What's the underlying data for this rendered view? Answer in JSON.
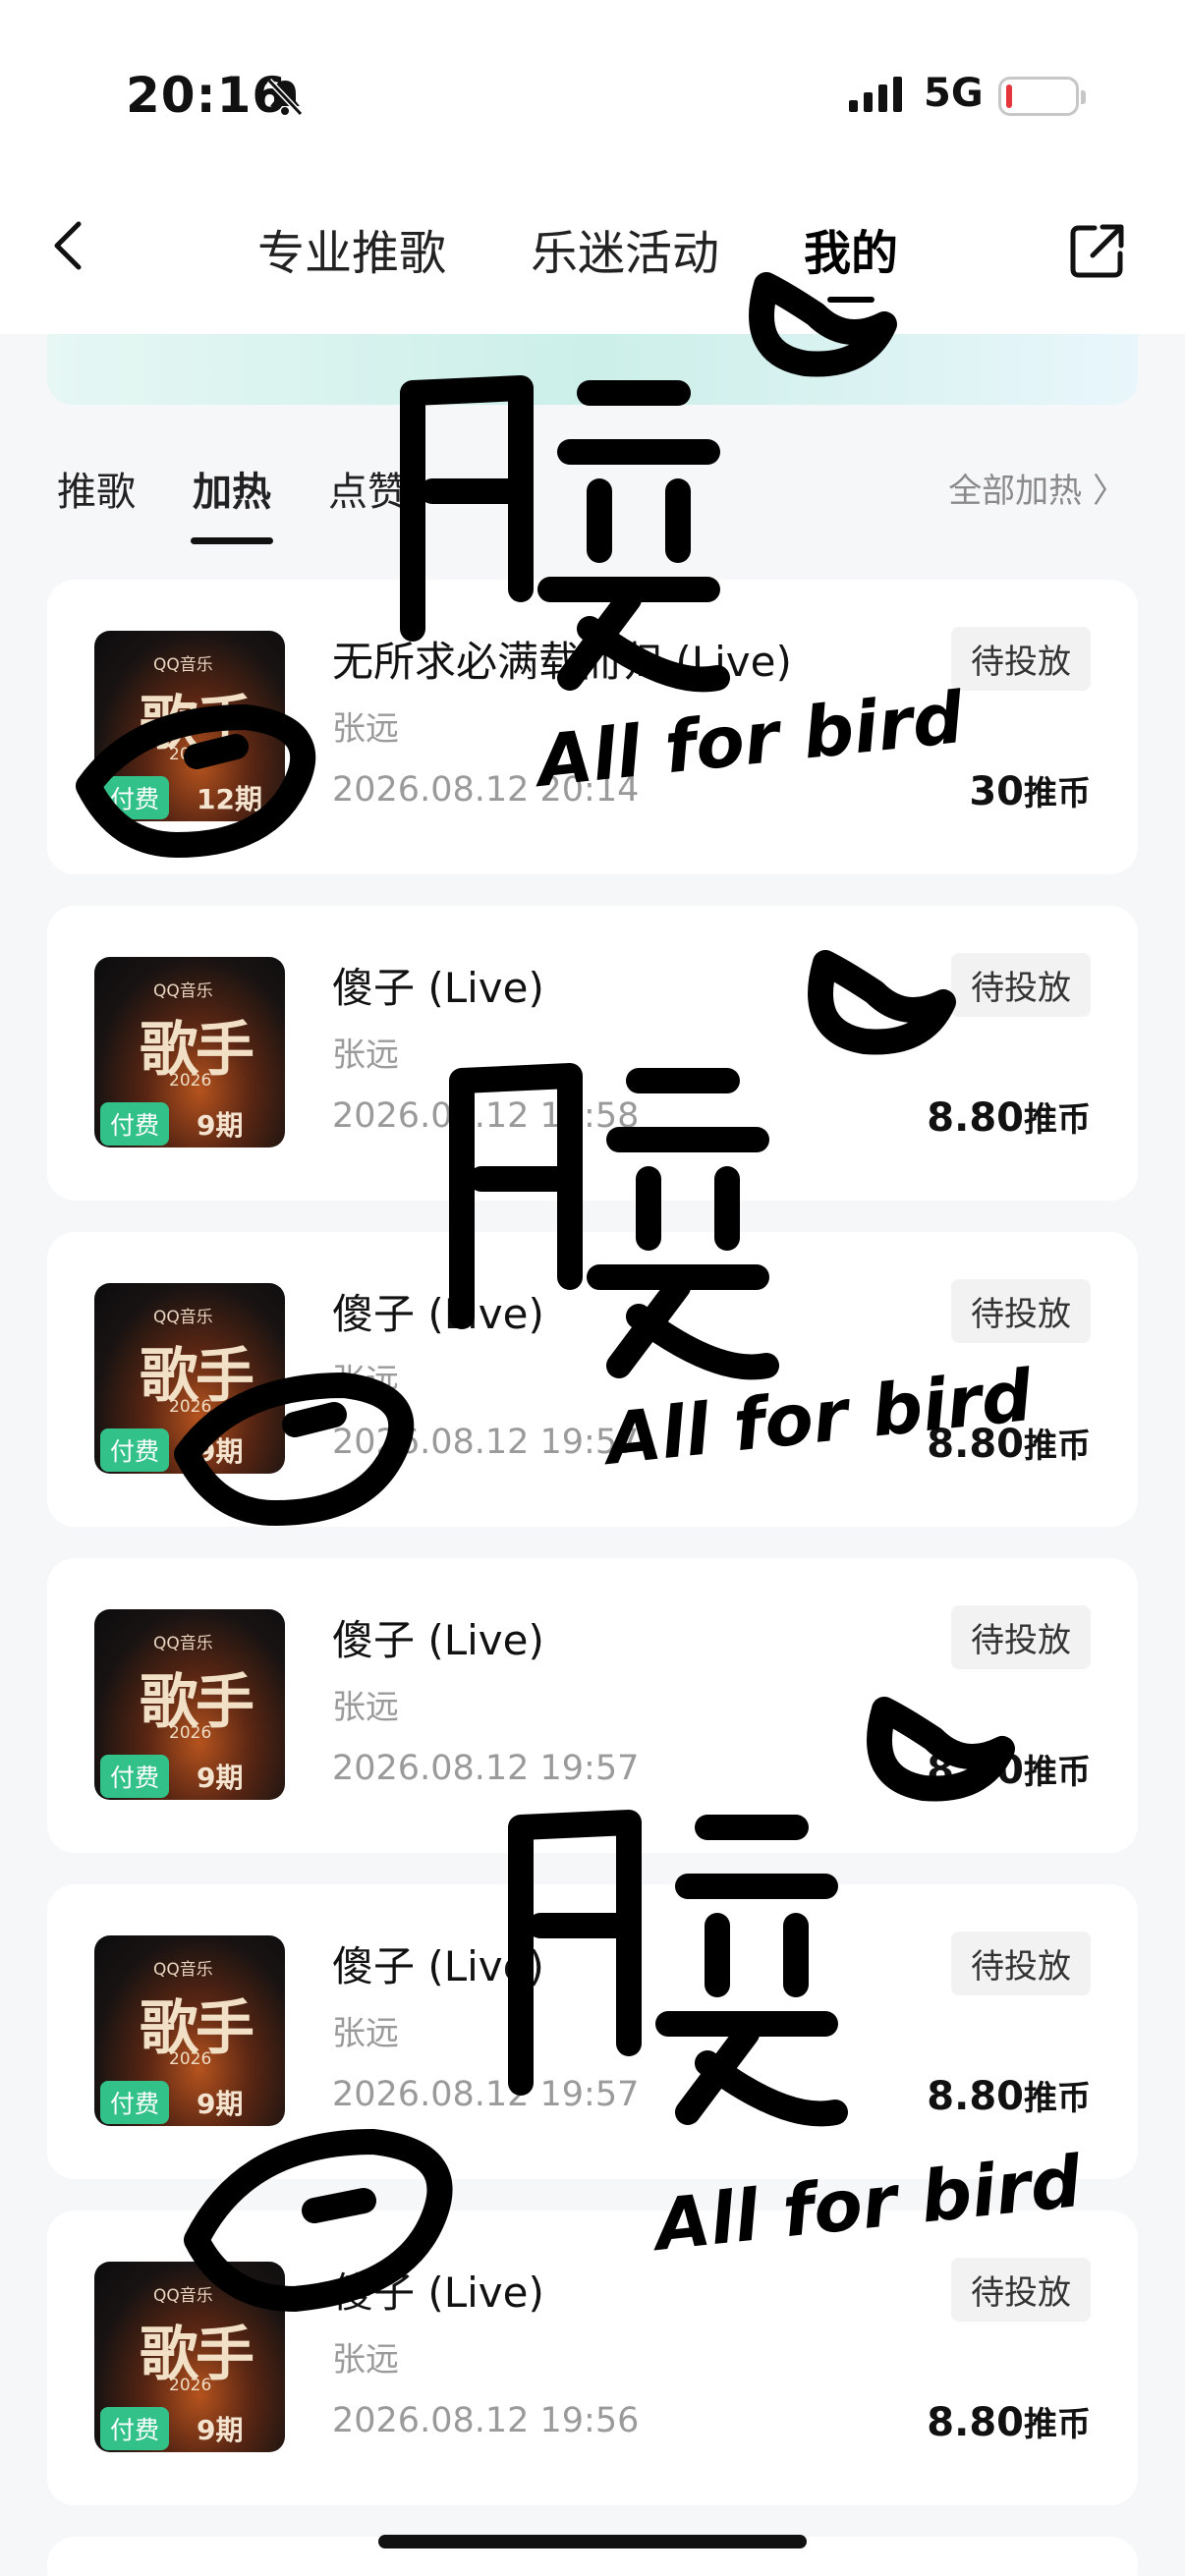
{
  "status_bar": {
    "time": "20:16",
    "network": "5G"
  },
  "nav": {
    "tabs": [
      {
        "label": "专业推歌"
      },
      {
        "label": "乐迷活动"
      },
      {
        "label": "我的"
      }
    ]
  },
  "sub_tabs": [
    {
      "label": "推歌"
    },
    {
      "label": "加热"
    },
    {
      "label": "点赞"
    }
  ],
  "all_boost": "全部加热 〉",
  "cover": {
    "brand": "QQ音乐",
    "show": "歌手",
    "year": "2026",
    "paid_badge": "付费"
  },
  "items": [
    {
      "song": "无所求必满载而归 (Live)",
      "artist": "张远",
      "time": "2026.08.12 20:14",
      "status": "待投放",
      "amount": "30",
      "unit": "推币",
      "episode": "12期"
    },
    {
      "song": "傻子 (Live)",
      "artist": "张远",
      "time": "2026.08.12 19:58",
      "status": "待投放",
      "amount": "8.80",
      "unit": "推币",
      "episode": "9期"
    },
    {
      "song": "傻子 (Live)",
      "artist": "张远",
      "time": "2026.08.12 19:57",
      "status": "待投放",
      "amount": "8.80",
      "unit": "推币",
      "episode": "9期"
    },
    {
      "song": "傻子 (Live)",
      "artist": "张远",
      "time": "2026.08.12 19:57",
      "status": "待投放",
      "amount": "8.80",
      "unit": "推币",
      "episode": "9期"
    },
    {
      "song": "傻子 (Live)",
      "artist": "张远",
      "time": "2026.08.12 19:57",
      "status": "待投放",
      "amount": "8.80",
      "unit": "推币",
      "episode": "9期"
    },
    {
      "song": "傻子 (Live)",
      "artist": "张远",
      "time": "2026.08.12 19:56",
      "status": "待投放",
      "amount": "8.80",
      "unit": "推币",
      "episode": "9期"
    }
  ],
  "watermark": {
    "name": "月雯",
    "text": "All for bird"
  }
}
